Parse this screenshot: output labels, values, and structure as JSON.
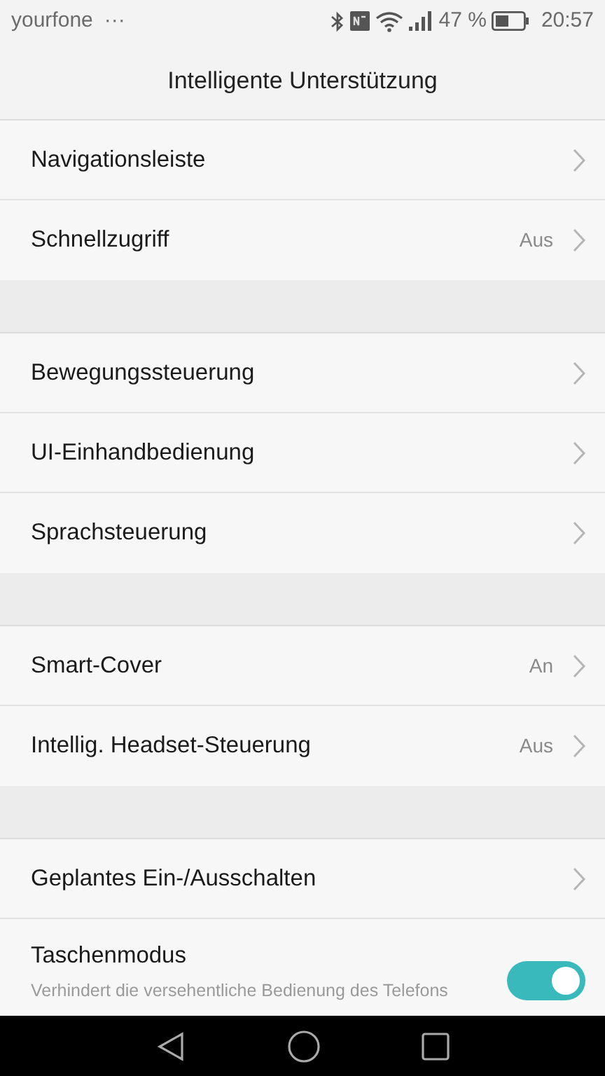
{
  "status_bar": {
    "carrier": "yourfone",
    "more": "···",
    "battery": "47 %",
    "time": "20:57"
  },
  "title": "Intelligente Unterstützung",
  "groups": [
    {
      "items": [
        {
          "kind": "link",
          "label": "Navigationsleiste"
        },
        {
          "kind": "link",
          "label": "Schnellzugriff",
          "value": "Aus"
        }
      ]
    },
    {
      "items": [
        {
          "kind": "link",
          "label": "Bewegungssteuerung"
        },
        {
          "kind": "link",
          "label": "UI-Einhandbedienung"
        },
        {
          "kind": "link",
          "label": "Sprachsteuerung"
        }
      ]
    },
    {
      "items": [
        {
          "kind": "link",
          "label": "Smart-Cover",
          "value": "An"
        },
        {
          "kind": "link",
          "label": "Intellig. Headset-Steuerung",
          "value": "Aus"
        }
      ]
    },
    {
      "items": [
        {
          "kind": "link",
          "label": "Geplantes Ein-/Ausschalten"
        },
        {
          "kind": "toggle",
          "label": "Taschenmodus",
          "description": "Verhindert die versehentliche Bedienung des Telefons",
          "on": true
        }
      ]
    }
  ]
}
